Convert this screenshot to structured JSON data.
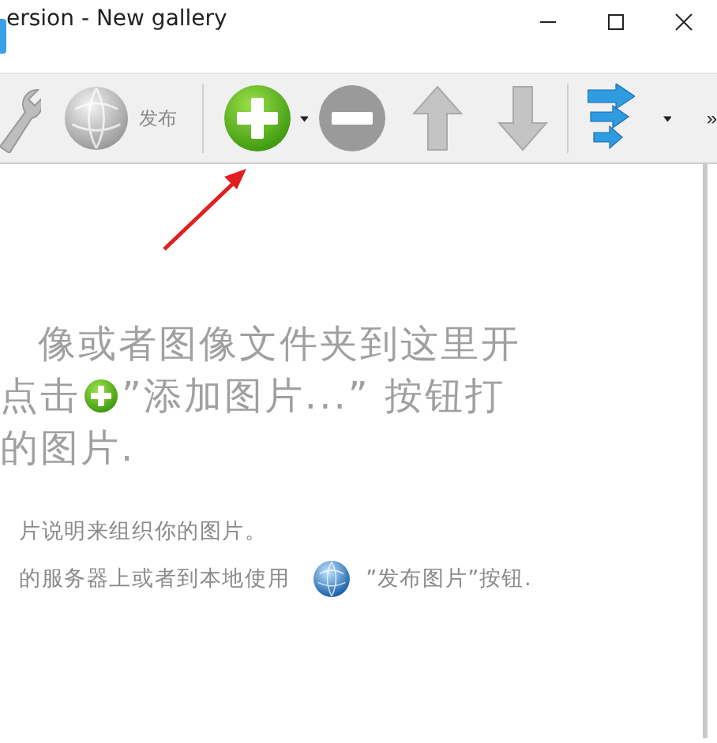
{
  "window": {
    "title": "ersion - New gallery"
  },
  "toolbar": {
    "publish_label": "发布",
    "buttons": [
      {
        "kind": "add",
        "disabled": false
      },
      {
        "kind": "remove",
        "disabled": true
      },
      {
        "kind": "up",
        "disabled": true
      },
      {
        "kind": "down",
        "disabled": true
      }
    ],
    "overflow": "»"
  },
  "hint": {
    "lines": [
      [
        {
          "kind": "text",
          "text": "像或者图像文件夹到这里开"
        }
      ],
      [
        {
          "kind": "text",
          "text": "点击"
        },
        {
          "kind": "add_icon"
        },
        {
          "kind": "text",
          "text": "”添加图片...” 按钮打"
        }
      ],
      [
        {
          "kind": "text",
          "text": "的图片."
        }
      ]
    ],
    "notes": [
      [
        {
          "kind": "text",
          "text": "片说明来组织你的图片。"
        }
      ],
      [
        {
          "kind": "text",
          "text": "的服务器上或者到本地使用"
        },
        {
          "kind": "globe_icon"
        },
        {
          "kind": "text",
          "text": "”发布图片”按钮."
        }
      ]
    ]
  }
}
